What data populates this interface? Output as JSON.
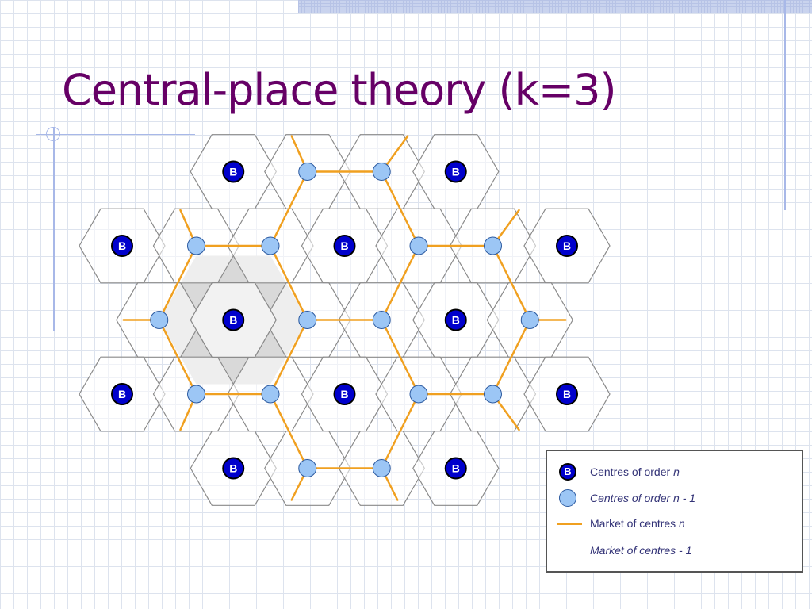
{
  "slide": {
    "title": "Central-place theory (k=3)"
  },
  "diagram": {
    "b_label": "B",
    "colors": {
      "hex_stroke": "#8a8a8a",
      "market_n_line": "#f0a020",
      "b_fill": "#0000cc",
      "b_text": "#ffffff",
      "small_centre_fill": "#9cc6f5",
      "small_centre_stroke": "#2c5aa0",
      "market_area_shade": "#d9d9d9",
      "title": "#660066"
    }
  },
  "legend": {
    "b_symbol": "B",
    "items": [
      {
        "symbol": "b-centre-icon",
        "text": "Centres of order ",
        "var": "n"
      },
      {
        "symbol": "small-centre-icon",
        "text": "Centres of order n - 1"
      },
      {
        "symbol": "orange-line-icon",
        "text": "Market of centres ",
        "var": "n"
      },
      {
        "symbol": "gray-line-icon",
        "text": "Market of centres  - 1"
      }
    ]
  }
}
